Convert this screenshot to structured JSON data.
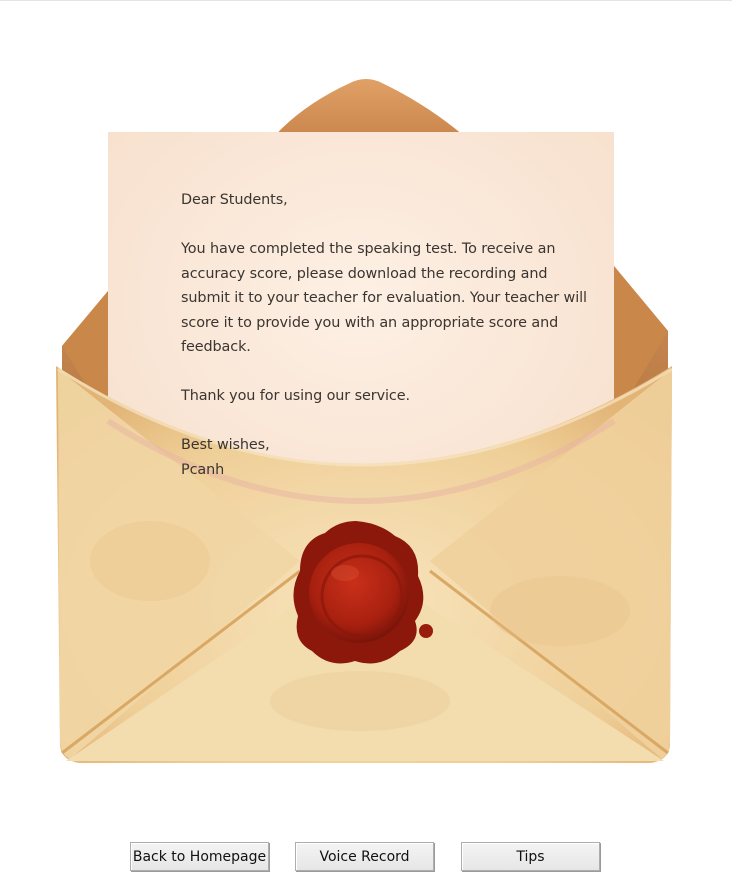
{
  "letter": {
    "greeting": "Dear Students,",
    "body": "You have completed the speaking test. To receive an accuracy score, please download the recording and submit it to your teacher for evaluation. Your teacher will score it to provide you with an appropriate score and feedback.",
    "thanks": "Thank you for using our service.",
    "closing": "Best wishes,",
    "signature": "Pcanh"
  },
  "buttons": {
    "back_home": "Back to Homepage",
    "voice_record": "Voice Record",
    "tips": "Tips"
  },
  "colors": {
    "paper": "#fbe8d8",
    "envelope": "#f0d09a",
    "flap": "#d9965a",
    "wax_seal": "#b0200f"
  }
}
